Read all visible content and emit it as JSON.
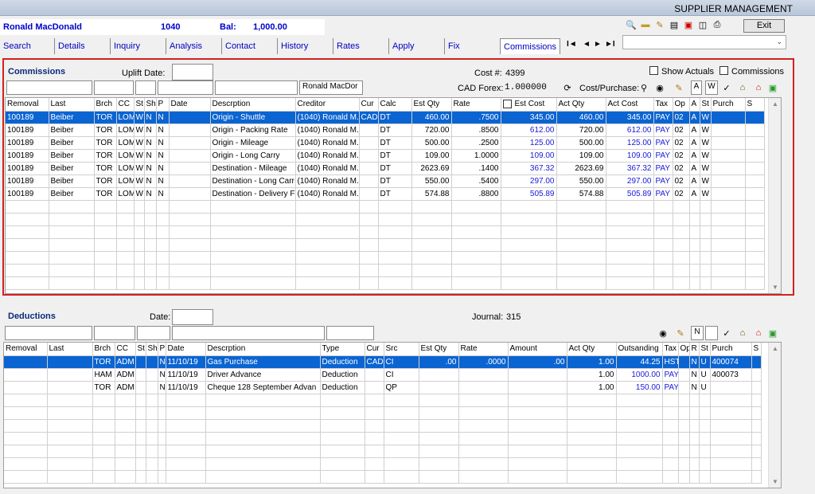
{
  "header": {
    "title": "SUPPLIER MANAGEMENT",
    "exit": "Exit"
  },
  "customer": {
    "name": "Ronald MacDonald",
    "id": "1040",
    "bal_label": "Bal:",
    "bal": "1,000.00"
  },
  "tabs": [
    "Search",
    "Details",
    "Inquiry",
    "Analysis",
    "Contact",
    "History",
    "Rates",
    "Apply",
    "Fix",
    "Commissions"
  ],
  "nav": {
    "first": "I◄",
    "prev": "◄",
    "next": "►",
    "last": "►I"
  },
  "commissions": {
    "title": "Commissions",
    "uplift_label": "Uplift Date:",
    "cost_label": "Cost #:",
    "cost": "4399",
    "show_actuals": "Show Actuals",
    "commissions_chk": "Commissions",
    "forex_label": "CAD Forex:",
    "forex": "1.000000",
    "cost_purchase": "Cost/Purchase:",
    "creditor_filter": "Ronald MacDor",
    "btn_a": "A",
    "btn_w": "W",
    "columns": [
      "Removal",
      "Last",
      "Brch",
      "CC",
      "St",
      "Sh",
      "P",
      "Date",
      "Descrption",
      "Creditor",
      "Cur",
      "Calc",
      "Est Qty",
      "Rate",
      "Est Cost",
      "Act Qty",
      "Act Cost",
      "Tax",
      "Op",
      "A",
      "St",
      "Purch",
      "S"
    ],
    "rows": [
      [
        "100189",
        "Beiber",
        "TOR",
        "LOM",
        "W",
        "N",
        "N",
        "",
        "Origin - Shuttle",
        "(1040) Ronald M.",
        "CAD",
        "DT",
        "460.00",
        ".7500",
        "345.00",
        "460.00",
        "345.00",
        "PAY",
        "02",
        "A",
        "W",
        "",
        ""
      ],
      [
        "100189",
        "Beiber",
        "TOR",
        "LOM",
        "W",
        "N",
        "N",
        "",
        "Origin - Packing Rate",
        "(1040) Ronald M.",
        "",
        "DT",
        "720.00",
        ".8500",
        "612.00",
        "720.00",
        "612.00",
        "PAY",
        "02",
        "A",
        "W",
        "",
        ""
      ],
      [
        "100189",
        "Beiber",
        "TOR",
        "LOM",
        "W",
        "N",
        "N",
        "",
        "Origin - Mileage",
        "(1040) Ronald M.",
        "",
        "DT",
        "500.00",
        ".2500",
        "125.00",
        "500.00",
        "125.00",
        "PAY",
        "02",
        "A",
        "W",
        "",
        ""
      ],
      [
        "100189",
        "Beiber",
        "TOR",
        "LOM",
        "W",
        "N",
        "N",
        "",
        "Origin - Long Carry",
        "(1040) Ronald M.",
        "",
        "DT",
        "109.00",
        "1.0000",
        "109.00",
        "109.00",
        "109.00",
        "PAY",
        "02",
        "A",
        "W",
        "",
        ""
      ],
      [
        "100189",
        "Beiber",
        "TOR",
        "LOM",
        "W",
        "N",
        "N",
        "",
        "Destination - Mileage",
        "(1040) Ronald M.",
        "",
        "DT",
        "2623.69",
        ".1400",
        "367.32",
        "2623.69",
        "367.32",
        "PAY",
        "02",
        "A",
        "W",
        "",
        ""
      ],
      [
        "100189",
        "Beiber",
        "TOR",
        "LOM",
        "W",
        "N",
        "N",
        "",
        "Destination - Long Carr",
        "(1040) Ronald M.",
        "",
        "DT",
        "550.00",
        ".5400",
        "297.00",
        "550.00",
        "297.00",
        "PAY",
        "02",
        "A",
        "W",
        "",
        ""
      ],
      [
        "100189",
        "Beiber",
        "TOR",
        "LOM",
        "W",
        "N",
        "N",
        "",
        "Destination - Delivery F",
        "(1040) Ronald M.",
        "",
        "DT",
        "574.88",
        ".8800",
        "505.89",
        "574.88",
        "505.89",
        "PAY",
        "02",
        "A",
        "W",
        "",
        ""
      ]
    ]
  },
  "deductions": {
    "title": "Deductions",
    "date_label": "Date:",
    "journal_label": "Journal:",
    "journal": "315",
    "filter_n": "N",
    "columns": [
      "Removal",
      "Last",
      "Brch",
      "CC",
      "St",
      "Sh",
      "P",
      "Date",
      "Descrption",
      "Type",
      "Cur",
      "Src",
      "Est Qty",
      "Rate",
      "Amount",
      "Act Qty",
      "Outsanding",
      "Tax",
      "Op",
      "R",
      "St",
      "Purch",
      "S"
    ],
    "rows": [
      [
        "",
        "",
        "TOR",
        "ADM",
        "",
        "",
        "N",
        "11/10/19",
        "Gas Purchase",
        "Deduction",
        "CAD",
        "CI",
        ".00",
        ".0000",
        ".00",
        "1.00",
        "44.25",
        "HST",
        "",
        "N",
        "U",
        "400074",
        ""
      ],
      [
        "",
        "",
        "HAM",
        "ADM",
        "",
        "",
        "N",
        "11/10/19",
        "Driver Advance",
        "Deduction",
        "",
        "CI",
        "",
        "",
        "",
        "1.00",
        "1000.00",
        "PAY",
        "",
        "N",
        "U",
        "400073",
        ""
      ],
      [
        "",
        "",
        "TOR",
        "ADM",
        "",
        "",
        "N",
        "11/10/19",
        "Cheque 128 September Advan",
        "Deduction",
        "",
        "QP",
        "",
        "",
        "",
        "1.00",
        "150.00",
        "PAY",
        "",
        "N",
        "U",
        "",
        ""
      ]
    ]
  }
}
